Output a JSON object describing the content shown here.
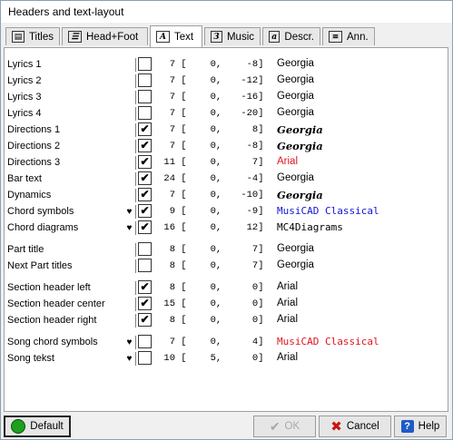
{
  "window": {
    "title": "Headers and text-layout"
  },
  "tabs": [
    {
      "label": "Titles",
      "icon": "titles-icon"
    },
    {
      "label": "Head+Foot",
      "icon": "headfoot-icon"
    },
    {
      "label": "Text",
      "icon": "text-icon",
      "active": true
    },
    {
      "label": "Music",
      "icon": "music-icon"
    },
    {
      "label": "Descr.",
      "icon": "description-icon"
    },
    {
      "label": "Ann.",
      "icon": "annotation-icon"
    }
  ],
  "rows": [
    {
      "label": "Lyrics 1",
      "heart": "",
      "checked": "",
      "size": "7",
      "x": "0",
      "y": "-8",
      "font": "Georgia",
      "style": "normal"
    },
    {
      "label": "Lyrics 2",
      "heart": "",
      "checked": "",
      "size": "7",
      "x": "0",
      "y": "-12",
      "font": "Georgia",
      "style": "normal"
    },
    {
      "label": "Lyrics 3",
      "heart": "",
      "checked": "",
      "size": "7",
      "x": "0",
      "y": "-16",
      "font": "Georgia",
      "style": "normal"
    },
    {
      "label": "Lyrics 4",
      "heart": "",
      "checked": "",
      "size": "7",
      "x": "0",
      "y": "-20",
      "font": "Georgia",
      "style": "normal"
    },
    {
      "label": "Directions 1",
      "heart": "",
      "checked": "✔",
      "size": "7",
      "x": "0",
      "y": "8",
      "font": "Georgia",
      "style": "bi"
    },
    {
      "label": "Directions 2",
      "heart": "",
      "checked": "✔",
      "size": "7",
      "x": "0",
      "y": "-8",
      "font": "Georgia",
      "style": "bi"
    },
    {
      "label": "Directions 3",
      "heart": "",
      "checked": "✔",
      "size": "11",
      "x": "0",
      "y": "7",
      "font": "Arial",
      "style": "red"
    },
    {
      "label": "Bar text",
      "heart": "",
      "checked": "✔",
      "size": "24",
      "x": "0",
      "y": "-4",
      "font": "Georgia",
      "style": "normal"
    },
    {
      "label": "Dynamics",
      "heart": "",
      "checked": "✔",
      "size": "7",
      "x": "0",
      "y": "-10",
      "font": "Georgia",
      "style": "bi"
    },
    {
      "label": "Chord symbols",
      "heart": "♥",
      "checked": "✔",
      "size": "9",
      "x": "0",
      "y": "-9",
      "font": "MusiCAD Classical",
      "style": "blue-mono"
    },
    {
      "label": "Chord diagrams",
      "heart": "♥",
      "checked": "✔",
      "size": "16",
      "x": "0",
      "y": "12",
      "font": "MC4Diagrams",
      "style": "mono"
    },
    {
      "label": "Part title",
      "heart": "",
      "checked": "",
      "size": "8",
      "x": "0",
      "y": "7",
      "font": "Georgia",
      "style": "normal"
    },
    {
      "label": "Next Part titles",
      "heart": "",
      "checked": "",
      "size": "8",
      "x": "0",
      "y": "7",
      "font": "Georgia",
      "style": "normal"
    },
    {
      "label": "Section header left",
      "heart": "",
      "checked": "✔",
      "size": "8",
      "x": "0",
      "y": "0",
      "font": "Arial",
      "style": "normal"
    },
    {
      "label": "Section header center",
      "heart": "",
      "checked": "✔",
      "size": "15",
      "x": "0",
      "y": "0",
      "font": "Arial",
      "style": "normal"
    },
    {
      "label": "Section header right",
      "heart": "",
      "checked": "✔",
      "size": "8",
      "x": "0",
      "y": "0",
      "font": "Arial",
      "style": "normal"
    },
    {
      "label": "Song chord symbols",
      "heart": "♥",
      "checked": "",
      "size": "7",
      "x": "0",
      "y": "4",
      "font": "MusiCAD Classical",
      "style": "red-mono"
    },
    {
      "label": "Song tekst",
      "heart": "♥",
      "checked": "",
      "size": "10",
      "x": "5",
      "y": "0",
      "font": "Arial",
      "style": "normal"
    }
  ],
  "buttons": {
    "default": "Default",
    "ok": "OK",
    "cancel": "Cancel",
    "help": "Help"
  },
  "colors": {
    "red": "#e0141e",
    "blue": "#1414d2",
    "green": "#1ea01e"
  }
}
